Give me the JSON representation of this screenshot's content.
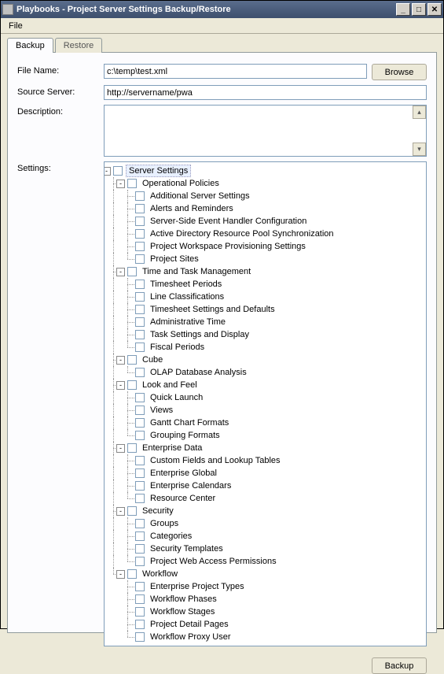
{
  "window": {
    "title": "Playbooks - Project Server Settings Backup/Restore"
  },
  "menu": {
    "file": "File"
  },
  "tabs": {
    "backup": "Backup",
    "restore": "Restore"
  },
  "labels": {
    "file_name": "File Name:",
    "source_server": "Source Server:",
    "description": "Description:",
    "settings": "Settings:"
  },
  "fields": {
    "file_name": "c:\\temp\\test.xml",
    "source_server": "http://servername/pwa",
    "description": ""
  },
  "buttons": {
    "browse": "Browse",
    "backup": "Backup"
  },
  "tree": {
    "root": "Server Settings",
    "groups": [
      {
        "label": "Operational Policies",
        "items": [
          "Additional Server Settings",
          "Alerts and Reminders",
          "Server-Side Event Handler Configuration",
          "Active Directory Resource Pool Synchronization",
          "Project Workspace Provisioning Settings",
          "Project Sites"
        ]
      },
      {
        "label": "Time and Task Management",
        "items": [
          "Timesheet Periods",
          "Line Classifications",
          "Timesheet Settings and Defaults",
          "Administrative Time",
          "Task Settings and Display",
          "Fiscal Periods"
        ]
      },
      {
        "label": "Cube",
        "items": [
          "OLAP Database Analysis"
        ]
      },
      {
        "label": "Look and Feel",
        "items": [
          "Quick Launch",
          "Views",
          "Gantt Chart Formats",
          "Grouping Formats"
        ]
      },
      {
        "label": "Enterprise Data",
        "items": [
          "Custom Fields and Lookup Tables",
          "Enterprise Global",
          "Enterprise Calendars",
          "Resource Center"
        ]
      },
      {
        "label": "Security",
        "items": [
          "Groups",
          "Categories",
          "Security Templates",
          "Project Web Access Permissions"
        ]
      },
      {
        "label": "Workflow",
        "items": [
          "Enterprise Project Types",
          "Workflow Phases",
          "Workflow Stages",
          "Project Detail Pages",
          "Workflow Proxy User"
        ]
      }
    ]
  }
}
